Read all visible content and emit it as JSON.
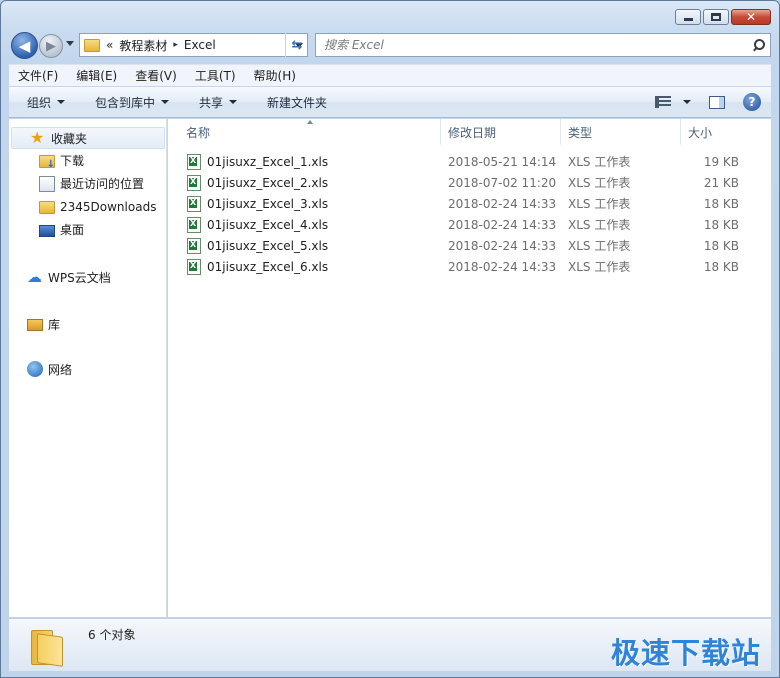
{
  "caption": {
    "minimize": "",
    "maximize": "",
    "close": "✕"
  },
  "nav": {
    "back": "◀",
    "forward": "▶"
  },
  "address": {
    "overflow": "«",
    "crumbs": [
      "教程素材",
      "Excel"
    ],
    "separator": "▸"
  },
  "search": {
    "placeholder": "搜索 Excel"
  },
  "menu": [
    "文件(F)",
    "编辑(E)",
    "查看(V)",
    "工具(T)",
    "帮助(H)"
  ],
  "commands": {
    "organize": "组织",
    "include_library": "包含到库中",
    "share": "共享",
    "new_folder": "新建文件夹",
    "help": "?"
  },
  "sidebar": {
    "favorites": {
      "label": "收藏夹",
      "items": [
        "下载",
        "最近访问的位置",
        "2345Downloads",
        "桌面"
      ]
    },
    "cloud": "WPS云文档",
    "libraries": "库",
    "network": "网络"
  },
  "columns": {
    "name": "名称",
    "date": "修改日期",
    "type": "类型",
    "size": "大小"
  },
  "files": [
    {
      "name": "01jisuxz_Excel_1.xls",
      "date": "2018-05-21 14:14",
      "type": "XLS 工作表",
      "size": "19 KB"
    },
    {
      "name": "01jisuxz_Excel_2.xls",
      "date": "2018-07-02 11:20",
      "type": "XLS 工作表",
      "size": "21 KB"
    },
    {
      "name": "01jisuxz_Excel_3.xls",
      "date": "2018-02-24 14:33",
      "type": "XLS 工作表",
      "size": "18 KB"
    },
    {
      "name": "01jisuxz_Excel_4.xls",
      "date": "2018-02-24 14:33",
      "type": "XLS 工作表",
      "size": "18 KB"
    },
    {
      "name": "01jisuxz_Excel_5.xls",
      "date": "2018-02-24 14:33",
      "type": "XLS 工作表",
      "size": "18 KB"
    },
    {
      "name": "01jisuxz_Excel_6.xls",
      "date": "2018-02-24 14:33",
      "type": "XLS 工作表",
      "size": "18 KB"
    }
  ],
  "status": {
    "count": "6 个对象"
  },
  "watermark": "极速下载站"
}
